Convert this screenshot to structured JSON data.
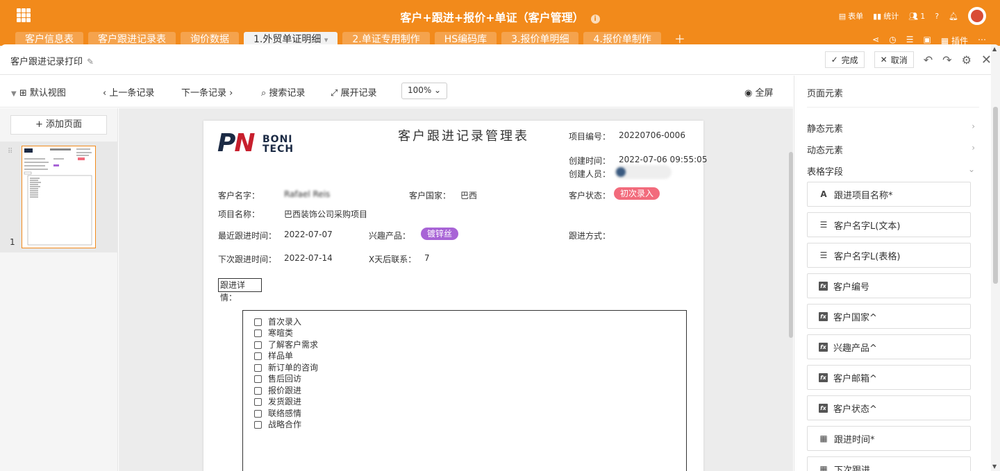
{
  "app": {
    "title": "客户+跟进+报价+单证（客户管理）",
    "info_icon": "info-icon",
    "top_actions": [
      {
        "icon": "table-icon",
        "label": "表单"
      },
      {
        "icon": "bar-chart-icon",
        "label": "统计"
      },
      {
        "icon": "users-icon",
        "label": "1"
      }
    ],
    "tabs": [
      "客户信息表",
      "客户跟进记录表",
      "询价数据",
      "1.外贸单证明细",
      "2.单证专用制作",
      "HS编码库",
      "3.报价单明细",
      "4.报价单制作"
    ],
    "active_tab": "1.外贸单证明细",
    "tab_dropdown": "▾",
    "plugin_label": "插件",
    "brand_color": "#f28a1b"
  },
  "editor": {
    "name": "客户跟进记录打印",
    "done_label": "完成",
    "cancel_label": "取消"
  },
  "toolbar": {
    "view": "默认视图",
    "prev": "上一条记录",
    "next": "下一条记录",
    "search": "搜索记录",
    "expand": "展开记录",
    "zoom": "100%",
    "fullscreen": "全屏"
  },
  "pages": {
    "add_label": "+ 添加页面",
    "page_number": "1"
  },
  "document": {
    "logo_letters": "PN",
    "logo_text_1": "BONI",
    "logo_text_2": "TECH",
    "title": "客户跟进记录管理表",
    "project_no_label": "项目编号：",
    "project_no": "20220706-0006",
    "created_time_label": "创建时间：",
    "created_time": "2022-07-06 09:55:05",
    "creator_label": "创建人员：",
    "customer_name_label": "客户名字：",
    "customer_name": "Rafael Reis",
    "customer_country_label": "客户国家：",
    "customer_country": "巴西",
    "customer_status_label": "客户状态：",
    "customer_status": "初次录入",
    "project_name_label": "项目名称：",
    "project_name": "巴西装饰公司采购项目",
    "last_follow_label": "最近跟进时间：",
    "last_follow": "2022-07-07",
    "interest_label": "兴趣产品：",
    "interest": "镀锌丝",
    "follow_method_label": "跟进方式：",
    "next_follow_label": "下次跟进时间：",
    "next_follow": "2022-07-14",
    "x_days_label": "X天后联系：",
    "x_days": "7",
    "detail_label": "跟进详情：",
    "checklist": [
      "首次录入",
      "寒暄类",
      "了解客户需求",
      "样品单",
      "新订单的咨询",
      "售后回访",
      "报价跟进",
      "发货跟进",
      "联络感情",
      "战略合作"
    ]
  },
  "right_panel": {
    "title": "页面元素",
    "sections": [
      "静态元素",
      "动态元素",
      "表格字段"
    ],
    "fields": [
      {
        "icon": "text-a-icon",
        "label": "跟进项目名称*"
      },
      {
        "icon": "link-list-icon",
        "label": "客户名字L(文本)"
      },
      {
        "icon": "link-list-icon",
        "label": "客户名字L(表格)"
      },
      {
        "icon": "formula-icon",
        "label": "客户编号"
      },
      {
        "icon": "formula-icon",
        "label": "客户国家^"
      },
      {
        "icon": "formula-icon",
        "label": "兴趣产品^"
      },
      {
        "icon": "formula-icon",
        "label": "客户邮箱^"
      },
      {
        "icon": "formula-icon",
        "label": "客户状态^"
      },
      {
        "icon": "calendar-icon",
        "label": "跟进时间*"
      },
      {
        "icon": "calendar-icon",
        "label": "下次跟进"
      }
    ]
  }
}
